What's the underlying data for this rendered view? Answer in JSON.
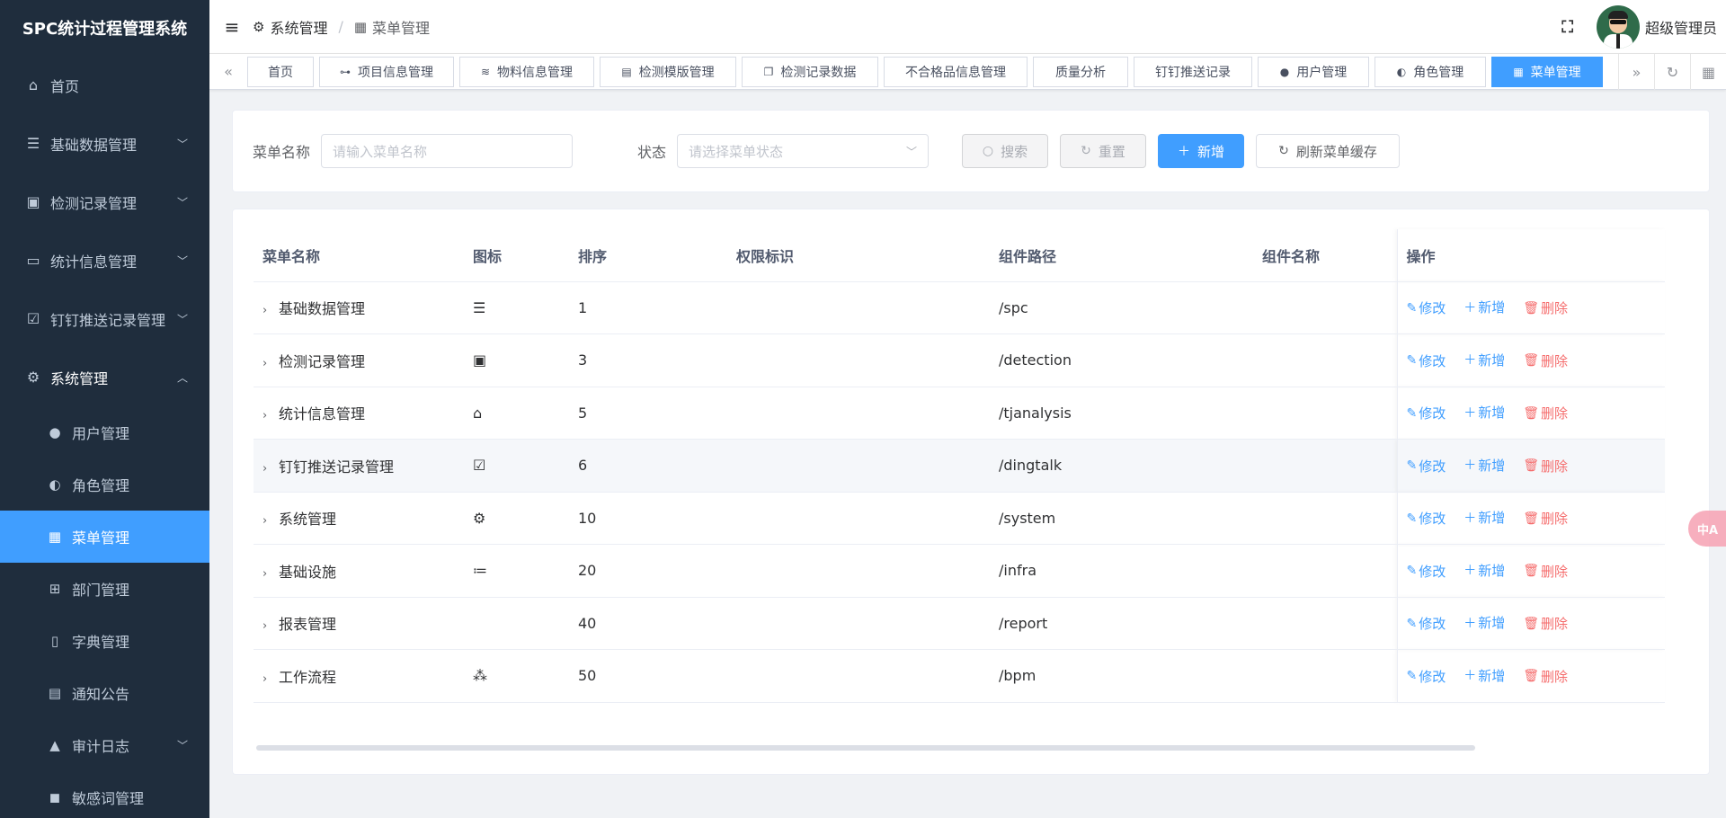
{
  "app": {
    "title": "SPC统计过程管理系统"
  },
  "sidebar": {
    "items": [
      {
        "label": "首页",
        "icon": "home-icon"
      },
      {
        "label": "基础数据管理",
        "icon": "list-icon"
      },
      {
        "label": "检测记录管理",
        "icon": "clipboard-icon"
      },
      {
        "label": "统计信息管理",
        "icon": "chart-board-icon"
      },
      {
        "label": "钉钉推送记录管理",
        "icon": "file-check-icon"
      },
      {
        "label": "系统管理",
        "icon": "gear-icon"
      }
    ],
    "sub_items": [
      {
        "label": "用户管理",
        "icon": "user-icon"
      },
      {
        "label": "角色管理",
        "icon": "role-icon"
      },
      {
        "label": "菜单管理",
        "icon": "grid-icon"
      },
      {
        "label": "部门管理",
        "icon": "org-icon"
      },
      {
        "label": "字典管理",
        "icon": "book-icon"
      },
      {
        "label": "通知公告",
        "icon": "notice-icon"
      },
      {
        "label": "审计日志",
        "icon": "audit-icon"
      },
      {
        "label": "敏感词管理",
        "icon": "ad-icon"
      }
    ]
  },
  "header": {
    "breadcrumb": [
      "系统管理",
      "菜单管理"
    ],
    "username": "超级管理员"
  },
  "tags": [
    {
      "label": "首页",
      "icon": ""
    },
    {
      "label": "项目信息管理",
      "icon": "branch-icon"
    },
    {
      "label": "物料信息管理",
      "icon": "database-icon"
    },
    {
      "label": "检测模版管理",
      "icon": "document-icon"
    },
    {
      "label": "检测记录数据",
      "icon": "copy-icon"
    },
    {
      "label": "不合格品信息管理",
      "icon": ""
    },
    {
      "label": "质量分析",
      "icon": ""
    },
    {
      "label": "钉钉推送记录",
      "icon": ""
    },
    {
      "label": "用户管理",
      "icon": "user-icon"
    },
    {
      "label": "角色管理",
      "icon": "role-icon"
    },
    {
      "label": "菜单管理",
      "icon": "grid-icon"
    }
  ],
  "search": {
    "name_label": "菜单名称",
    "name_placeholder": "请输入菜单名称",
    "status_label": "状态",
    "status_placeholder": "请选择菜单状态",
    "search_btn": "搜索",
    "reset_btn": "重置",
    "add_btn": "新增",
    "refresh_btn": "刷新菜单缓存"
  },
  "table": {
    "columns": [
      "菜单名称",
      "图标",
      "排序",
      "权限标识",
      "组件路径",
      "组件名称",
      "操作"
    ],
    "ops": {
      "edit": "修改",
      "add": "新增",
      "delete": "删除"
    },
    "rows": [
      {
        "name": "基础数据管理",
        "icon": "list-icon",
        "icon_char": "☰",
        "order": "1",
        "perm": "",
        "path": "/spc",
        "comp": ""
      },
      {
        "name": "检测记录管理",
        "icon": "clipboard-icon",
        "icon_char": "▣",
        "order": "3",
        "perm": "",
        "path": "/detection",
        "comp": ""
      },
      {
        "name": "统计信息管理",
        "icon": "chart-board-icon",
        "icon_char": "⌂",
        "order": "5",
        "perm": "",
        "path": "/tjanalysis",
        "comp": ""
      },
      {
        "name": "钉钉推送记录管理",
        "icon": "file-check-icon",
        "icon_char": "☑",
        "order": "6",
        "perm": "",
        "path": "/dingtalk",
        "comp": ""
      },
      {
        "name": "系统管理",
        "icon": "gear-icon",
        "icon_char": "⚙",
        "order": "10",
        "perm": "",
        "path": "/system",
        "comp": ""
      },
      {
        "name": "基础设施",
        "icon": "list-icon",
        "icon_char": "≔",
        "order": "20",
        "perm": "",
        "path": "/infra",
        "comp": ""
      },
      {
        "name": "报表管理",
        "icon": "",
        "icon_char": "",
        "order": "40",
        "perm": "",
        "path": "/report",
        "comp": ""
      },
      {
        "name": "工作流程",
        "icon": "flow-icon",
        "icon_char": "⁂",
        "order": "50",
        "perm": "",
        "path": "/bpm",
        "comp": ""
      }
    ]
  },
  "colors": {
    "primary": "#409eff",
    "sidebar_bg": "#1f2d3d",
    "danger": "#f56c6c"
  }
}
